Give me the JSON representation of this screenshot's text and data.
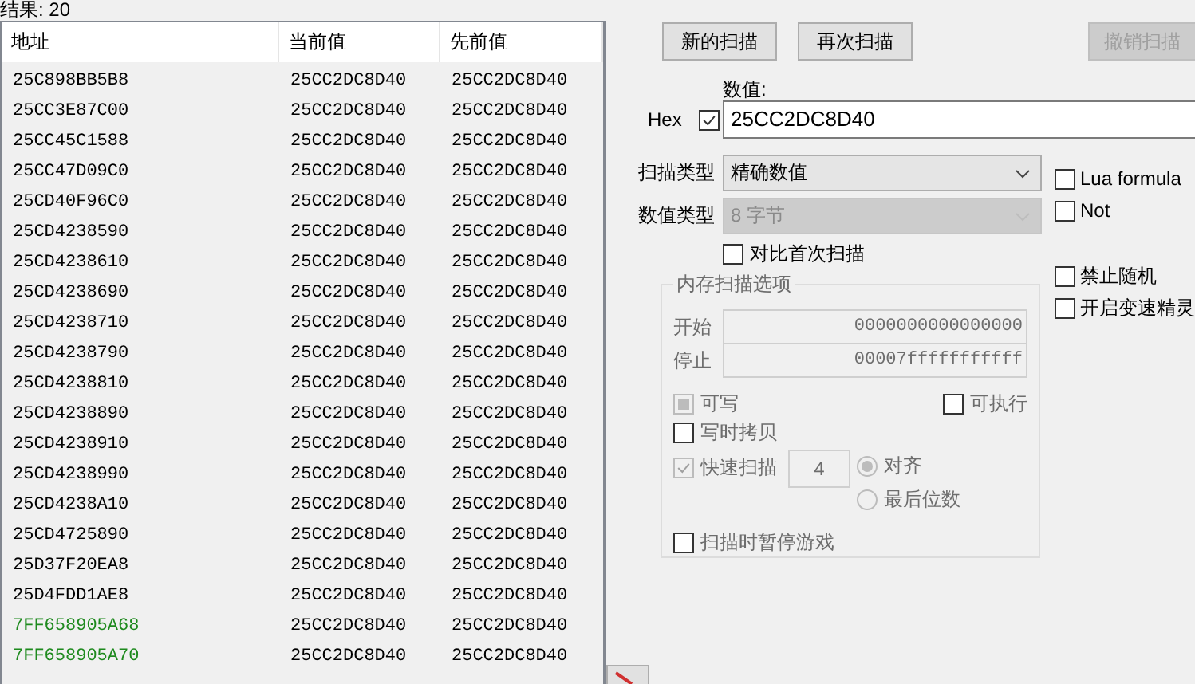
{
  "results_label": "结果: 20",
  "table": {
    "columns": [
      "地址",
      "当前值",
      "先前值"
    ],
    "rows": [
      {
        "kind": "dynamic",
        "cells": [
          "25C898BB5B8",
          "25CC2DC8D40",
          "25CC2DC8D40"
        ]
      },
      {
        "kind": "dynamic",
        "cells": [
          "25CC3E87C00",
          "25CC2DC8D40",
          "25CC2DC8D40"
        ]
      },
      {
        "kind": "dynamic",
        "cells": [
          "25CC45C1588",
          "25CC2DC8D40",
          "25CC2DC8D40"
        ]
      },
      {
        "kind": "dynamic",
        "cells": [
          "25CC47D09C0",
          "25CC2DC8D40",
          "25CC2DC8D40"
        ]
      },
      {
        "kind": "dynamic",
        "cells": [
          "25CD40F96C0",
          "25CC2DC8D40",
          "25CC2DC8D40"
        ]
      },
      {
        "kind": "dynamic",
        "cells": [
          "25CD4238590",
          "25CC2DC8D40",
          "25CC2DC8D40"
        ]
      },
      {
        "kind": "dynamic",
        "cells": [
          "25CD4238610",
          "25CC2DC8D40",
          "25CC2DC8D40"
        ]
      },
      {
        "kind": "dynamic",
        "cells": [
          "25CD4238690",
          "25CC2DC8D40",
          "25CC2DC8D40"
        ]
      },
      {
        "kind": "dynamic",
        "cells": [
          "25CD4238710",
          "25CC2DC8D40",
          "25CC2DC8D40"
        ]
      },
      {
        "kind": "dynamic",
        "cells": [
          "25CD4238790",
          "25CC2DC8D40",
          "25CC2DC8D40"
        ]
      },
      {
        "kind": "dynamic",
        "cells": [
          "25CD4238810",
          "25CC2DC8D40",
          "25CC2DC8D40"
        ]
      },
      {
        "kind": "dynamic",
        "cells": [
          "25CD4238890",
          "25CC2DC8D40",
          "25CC2DC8D40"
        ]
      },
      {
        "kind": "dynamic",
        "cells": [
          "25CD4238910",
          "25CC2DC8D40",
          "25CC2DC8D40"
        ]
      },
      {
        "kind": "dynamic",
        "cells": [
          "25CD4238990",
          "25CC2DC8D40",
          "25CC2DC8D40"
        ]
      },
      {
        "kind": "dynamic",
        "cells": [
          "25CD4238A10",
          "25CC2DC8D40",
          "25CC2DC8D40"
        ]
      },
      {
        "kind": "dynamic",
        "cells": [
          "25CD4725890",
          "25CC2DC8D40",
          "25CC2DC8D40"
        ]
      },
      {
        "kind": "dynamic",
        "cells": [
          "25D37F20EA8",
          "25CC2DC8D40",
          "25CC2DC8D40"
        ]
      },
      {
        "kind": "dynamic",
        "cells": [
          "25D4FDD1AE8",
          "25CC2DC8D40",
          "25CC2DC8D40"
        ]
      },
      {
        "kind": "static",
        "cells": [
          "7FF658905A68",
          "25CC2DC8D40",
          "25CC2DC8D40"
        ]
      },
      {
        "kind": "static",
        "cells": [
          "7FF658905A70",
          "25CC2DC8D40",
          "25CC2DC8D40"
        ]
      }
    ]
  },
  "buttons": [
    {
      "label": "新的扫描",
      "disabled": false
    },
    {
      "label": "再次扫描",
      "disabled": false
    },
    {
      "label": "撤销扫描",
      "disabled": true
    }
  ],
  "value": {
    "label": "数值:",
    "hex_label": "Hex",
    "hex_checked": true,
    "value": "25CC2DC8D40"
  },
  "scan_type": {
    "label": "扫描类型",
    "value": "精确数值",
    "disabled": false
  },
  "value_type": {
    "label": "数值类型",
    "value": "8 字节",
    "disabled": true
  },
  "compare_first": {
    "label": "对比首次扫描",
    "checked": false
  },
  "options_top": [
    {
      "label": "Lua formula",
      "checked": false
    },
    {
      "label": "Not",
      "checked": false
    }
  ],
  "options_bottom": [
    {
      "label": "禁止随机",
      "checked": false
    },
    {
      "label": "开启变速精灵",
      "checked": false
    }
  ],
  "memory_options": {
    "title": "内存扫描选项",
    "disabled": true,
    "start": {
      "label": "开始",
      "value": "0000000000000000"
    },
    "stop": {
      "label": "停止",
      "value": "00007fffffffffff"
    },
    "writable": {
      "label": "可写",
      "checked": true,
      "indeterminate": true
    },
    "executable": {
      "label": "可执行",
      "checked": false
    },
    "copy_on_write": {
      "label": "写时拷贝",
      "checked": false
    },
    "fast_scan": {
      "label": "快速扫描",
      "checked": true,
      "value": "4"
    },
    "alignment": [
      {
        "label": "对齐",
        "selected": true
      },
      {
        "label": "最后位数",
        "selected": false
      }
    ],
    "pause_game": {
      "label": "扫描时暂停游戏",
      "checked": false
    }
  }
}
